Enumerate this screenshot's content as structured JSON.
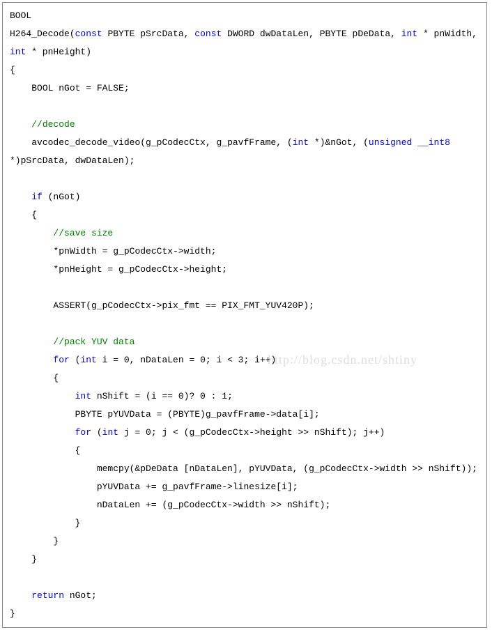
{
  "code": {
    "line1_type": "BOOL",
    "line2_fn": "H264_Decode(",
    "line2_const1": "const",
    "line2_p1": " PBYTE pSrcData, ",
    "line2_const2": "const",
    "line2_p2": " DWORD dwDataLen, PBYTE pDeData, ",
    "line2_int": "int",
    "line2_p3": " * pnWidth, ",
    "line3_int": "int",
    "line3_rest": " * pnHeight)",
    "line4": "{",
    "line5": "    BOOL nGot = FALSE;",
    "line6": "",
    "line7_indent": "    ",
    "line7_comment": "//decode",
    "line8_a": "    avcodec_decode_video(g_pCodecCtx, g_pavfFrame, (",
    "line8_int": "int",
    "line8_b": " *)&nGot, (",
    "line8_unsigned": "unsigned",
    "line8_c": " ",
    "line8_int8": "__int8",
    "line8_d": " *)pSrcData, dwDataLen);",
    "line9": "",
    "line10_indent": "    ",
    "line10_if": "if",
    "line10_rest": " (nGot)",
    "line11": "    {",
    "line12_indent": "        ",
    "line12_comment": "//save size",
    "line13": "        *pnWidth = g_pCodecCtx->width;",
    "line14": "        *pnHeight = g_pCodecCtx->height;",
    "line15": "",
    "line16": "        ASSERT(g_pCodecCtx->pix_fmt == PIX_FMT_YUV420P);",
    "line17": "",
    "line18_indent": "        ",
    "line18_comment": "//pack YUV data",
    "line19_indent": "        ",
    "line19_for": "for",
    "line19_a": " (",
    "line19_int": "int",
    "line19_b": " i = 0, nDataLen = 0; i < 3; i++)",
    "line20": "        {",
    "line21_indent": "            ",
    "line21_int": "int",
    "line21_rest": " nShift = (i == 0)? 0 : 1;",
    "line22": "            PBYTE pYUVData = (PBYTE)g_pavfFrame->data[i];",
    "line23_indent": "            ",
    "line23_for": "for",
    "line23_a": " (",
    "line23_int": "int",
    "line23_b": " j = 0; j < (g_pCodecCtx->height >> nShift); j++)",
    "line24": "            {",
    "line25": "                memcpy(&pDeData [nDataLen], pYUVData, (g_pCodecCtx->width >> nShift));",
    "line26": "                pYUVData += g_pavfFrame->linesize[i];",
    "line27": "                nDataLen += (g_pCodecCtx->width >> nShift);",
    "line28": "            }",
    "line29": "        }",
    "line30": "    }",
    "line31": "",
    "line32_indent": "    ",
    "line32_return": "return",
    "line32_rest": " nGot;",
    "line33": "}"
  },
  "watermark": "http://blog.csdn.net/shtiny"
}
